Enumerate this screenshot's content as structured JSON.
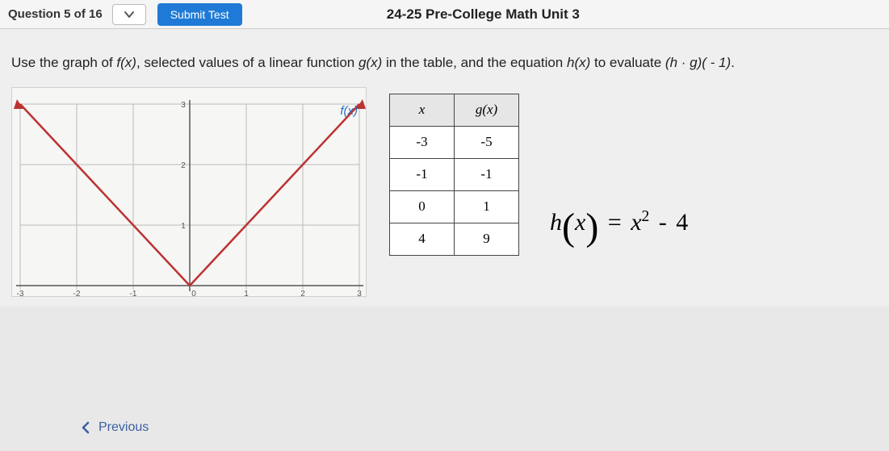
{
  "header": {
    "question_label": "Question 5 of 16",
    "submit_label": "Submit Test",
    "course_title": "24-25 Pre-College Math Unit 3"
  },
  "prompt": {
    "text_parts": [
      "Use the graph of ",
      "f(x)",
      ", selected values of a linear function ",
      "g(x)",
      " in the table, and the equation ",
      "h(x)",
      " to evaluate ",
      "(h · g)( - 1)",
      "."
    ]
  },
  "graph": {
    "function_label": "f(x)",
    "x_range": [
      -3,
      3
    ],
    "y_range": [
      0,
      3
    ],
    "lines": [
      {
        "from": [
          -3,
          3
        ],
        "to": [
          0,
          0
        ]
      },
      {
        "from": [
          0,
          0
        ],
        "to": [
          3,
          3
        ]
      }
    ]
  },
  "table": {
    "headers": [
      "x",
      "g(x)"
    ],
    "rows": [
      [
        "-3",
        "-5"
      ],
      [
        "-1",
        "-1"
      ],
      [
        "0",
        "1"
      ],
      [
        "4",
        "9"
      ]
    ]
  },
  "equation": {
    "lhs_func": "h",
    "lhs_var": "x",
    "rhs_base": "x",
    "rhs_exp": "2",
    "rhs_op": "-",
    "rhs_const": "4"
  },
  "nav": {
    "previous_label": "Previous"
  }
}
